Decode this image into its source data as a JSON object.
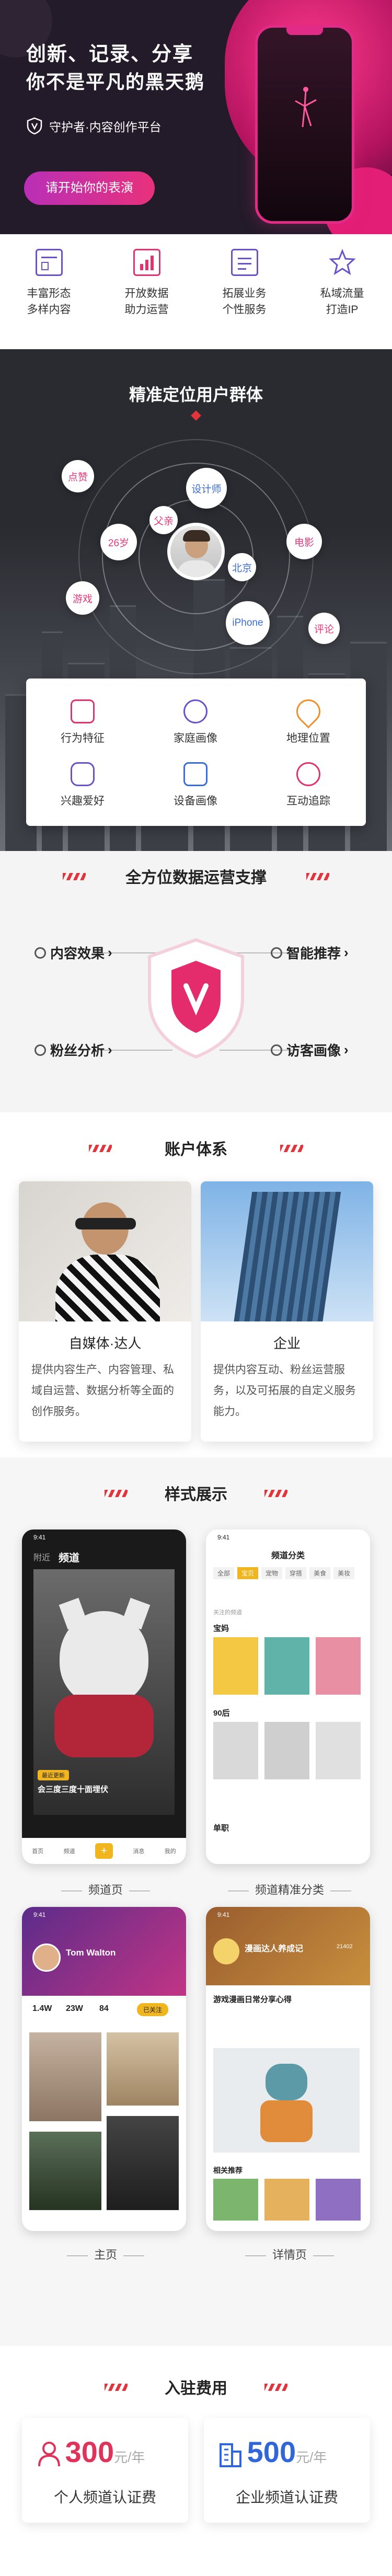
{
  "hero": {
    "title": "创新、记录、分享",
    "subtitle": "你不是平凡的黑天鹅",
    "tagline": "守护者·内容创作平台",
    "cta": "请开始你的表演"
  },
  "features": [
    {
      "l1": "丰富形态",
      "l2": "多样内容",
      "icon": "layout-icon"
    },
    {
      "l1": "开放数据",
      "l2": "助力运营",
      "icon": "data-icon"
    },
    {
      "l1": "拓展业务",
      "l2": "个性服务",
      "icon": "doc-icon"
    },
    {
      "l1": "私域流量",
      "l2": "打造IP",
      "icon": "star-icon"
    }
  ],
  "targeting": {
    "title": "精准定位用户群体",
    "tags": [
      "点赞",
      "设计师",
      "父亲",
      "26岁",
      "北京",
      "电影",
      "游戏",
      "iPhone",
      "评论"
    ],
    "grid": [
      "行为特征",
      "家庭画像",
      "地理位置",
      "兴趣爱好",
      "设备画像",
      "互动追踪"
    ]
  },
  "ops": {
    "title": "全方位数据运营支撑",
    "labels": [
      "内容效果",
      "智能推荐",
      "粉丝分析",
      "访客画像"
    ]
  },
  "account": {
    "title": "账户体系",
    "cards": [
      {
        "title": "自媒体·达人",
        "desc": "提供内容生产、内容管理、私域自运营、数据分析等全面的创作服务。"
      },
      {
        "title": "企业",
        "desc": "提供内容互动、粉丝运营服务，以及可拓展的自定义服务能力。"
      }
    ]
  },
  "showcase": {
    "title": "样式展示",
    "captions": [
      "频道页",
      "频道精准分类",
      "主页",
      "详情页"
    ],
    "p1": {
      "time": "9:41",
      "nav1": "附近",
      "nav2": "频道",
      "badge": "最近更新",
      "text": "会三度三度十面埋伏",
      "tabs": [
        "首页",
        "频道",
        "+",
        "消息",
        "我的"
      ]
    },
    "p2": {
      "time": "9:41",
      "title": "频道分类",
      "cats": [
        "全部",
        "宝贝",
        "宠物",
        "穿搭",
        "美食",
        "美妆"
      ],
      "tag": "关注的频道",
      "sec1": "宝妈",
      "sec2": "90后",
      "sec3": "单职"
    },
    "p3": {
      "time": "9:41",
      "name": "Tom Walton",
      "stats": [
        "1.4W",
        "23W",
        "84"
      ],
      "follow": "已关注"
    },
    "p4": {
      "time": "9:41",
      "title": "漫画达人养成记",
      "count": "21402",
      "head": "游戏漫画日常分享心得",
      "more": "相关推荐"
    }
  },
  "fees": {
    "title": "入驻费用",
    "items": [
      {
        "price": "300",
        "unit": "元/年",
        "label": "个人频道认证费",
        "color": "#e0335a"
      },
      {
        "price": "500",
        "unit": "元/年",
        "label": "企业频道认证费",
        "color": "#3066d8"
      }
    ]
  }
}
